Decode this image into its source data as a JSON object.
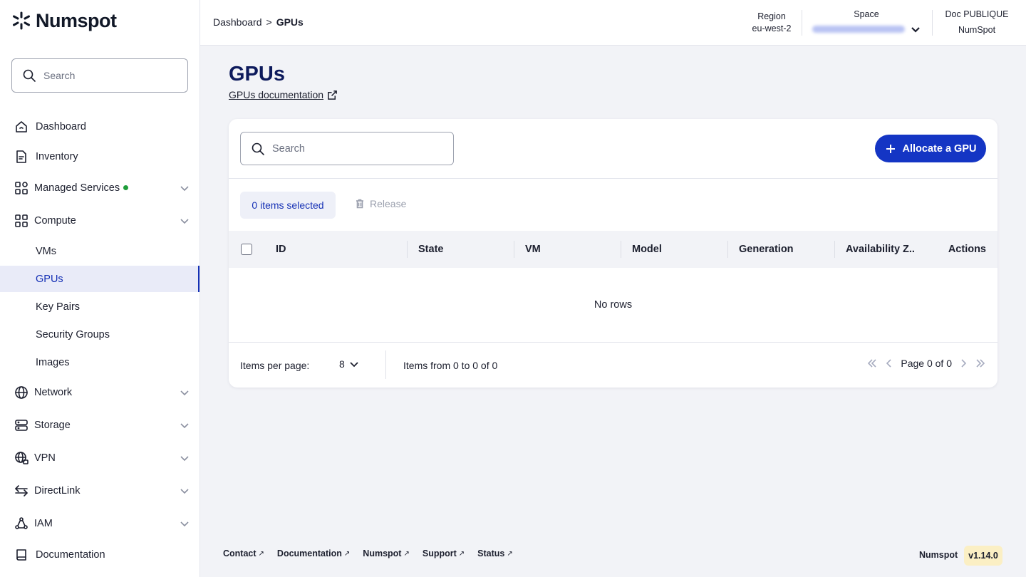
{
  "brand": {
    "name": "Numspot"
  },
  "sidebar": {
    "search_placeholder": "Search",
    "items": {
      "dashboard": "Dashboard",
      "inventory": "Inventory",
      "managed_services": "Managed Services",
      "compute": "Compute",
      "vms": "VMs",
      "gpus": "GPUs",
      "key_pairs": "Key Pairs",
      "security_groups": "Security Groups",
      "images": "Images",
      "network": "Network",
      "storage": "Storage",
      "vpn": "VPN",
      "directlink": "DirectLink",
      "iam": "IAM",
      "documentation": "Documentation"
    },
    "active_item": "GPUs",
    "status_dot_color": "#1f9d3a"
  },
  "header": {
    "breadcrumb": {
      "parent": "Dashboard",
      "separator": ">",
      "current": "GPUs"
    },
    "region_label": "Region",
    "region_value": "eu-west-2",
    "space_label": "Space",
    "doc_label": "Doc PUBLIQUE",
    "doc_value": "NumSpot"
  },
  "main": {
    "title": "GPUs",
    "doc_link": "GPUs documentation",
    "search_placeholder": "Search",
    "allocate_button": "Allocate a GPU",
    "selected_text": "0 items selected",
    "release_button": "Release",
    "columns": {
      "id": "ID",
      "state": "State",
      "vm": "VM",
      "model": "Model",
      "generation": "Generation",
      "availability_zone": "Availability Z..",
      "actions": "Actions"
    },
    "empty_text": "No rows",
    "pagination": {
      "items_per_page_label": "Items per page:",
      "items_per_page_value": "8",
      "range_text": "Items from 0 to 0 of 0",
      "page_text": "Page 0 of 0"
    }
  },
  "footer": {
    "links": {
      "contact": "Contact",
      "documentation": "Documentation",
      "numspot": "Numspot",
      "support": "Support",
      "status": "Status"
    },
    "brand": "Numspot",
    "version": "v1.14.0"
  },
  "colors": {
    "primary": "#1435c4",
    "title": "#0d1a5c",
    "version_badge": "#fbefc4"
  }
}
